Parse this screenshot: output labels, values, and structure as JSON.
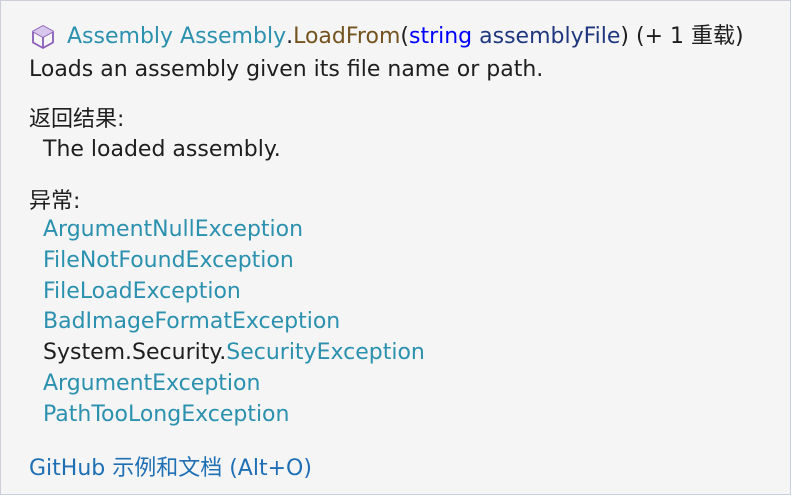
{
  "signature": {
    "return_type": "Assembly",
    "class_name": "Assembly",
    "dot": ".",
    "method": "LoadFrom",
    "open_paren": "(",
    "param_type": "string",
    "param_name": "assemblyFile",
    "close_paren": ")",
    "overload_note": "(+ 1 重载)",
    "icon": "method-cube-icon"
  },
  "summary": "Loads an assembly given its file name or path.",
  "returns": {
    "heading": "返回结果:",
    "value": "The loaded assembly."
  },
  "exceptions": {
    "heading": "异常:",
    "items": [
      {
        "ns": "",
        "name": "ArgumentNullException"
      },
      {
        "ns": "",
        "name": "FileNotFoundException"
      },
      {
        "ns": "",
        "name": "FileLoadException"
      },
      {
        "ns": "",
        "name": "BadImageFormatException"
      },
      {
        "ns": "System.Security.",
        "name": "SecurityException"
      },
      {
        "ns": "",
        "name": "ArgumentException"
      },
      {
        "ns": "",
        "name": "PathTooLongException"
      }
    ]
  },
  "footer_link": "GitHub 示例和文档 (Alt+O)",
  "colors": {
    "type": "#2b91af",
    "method": "#74531f",
    "keyword": "#0000ff",
    "param": "#1f377f",
    "link": "#1f6fb5",
    "icon": "#8a5db8"
  }
}
